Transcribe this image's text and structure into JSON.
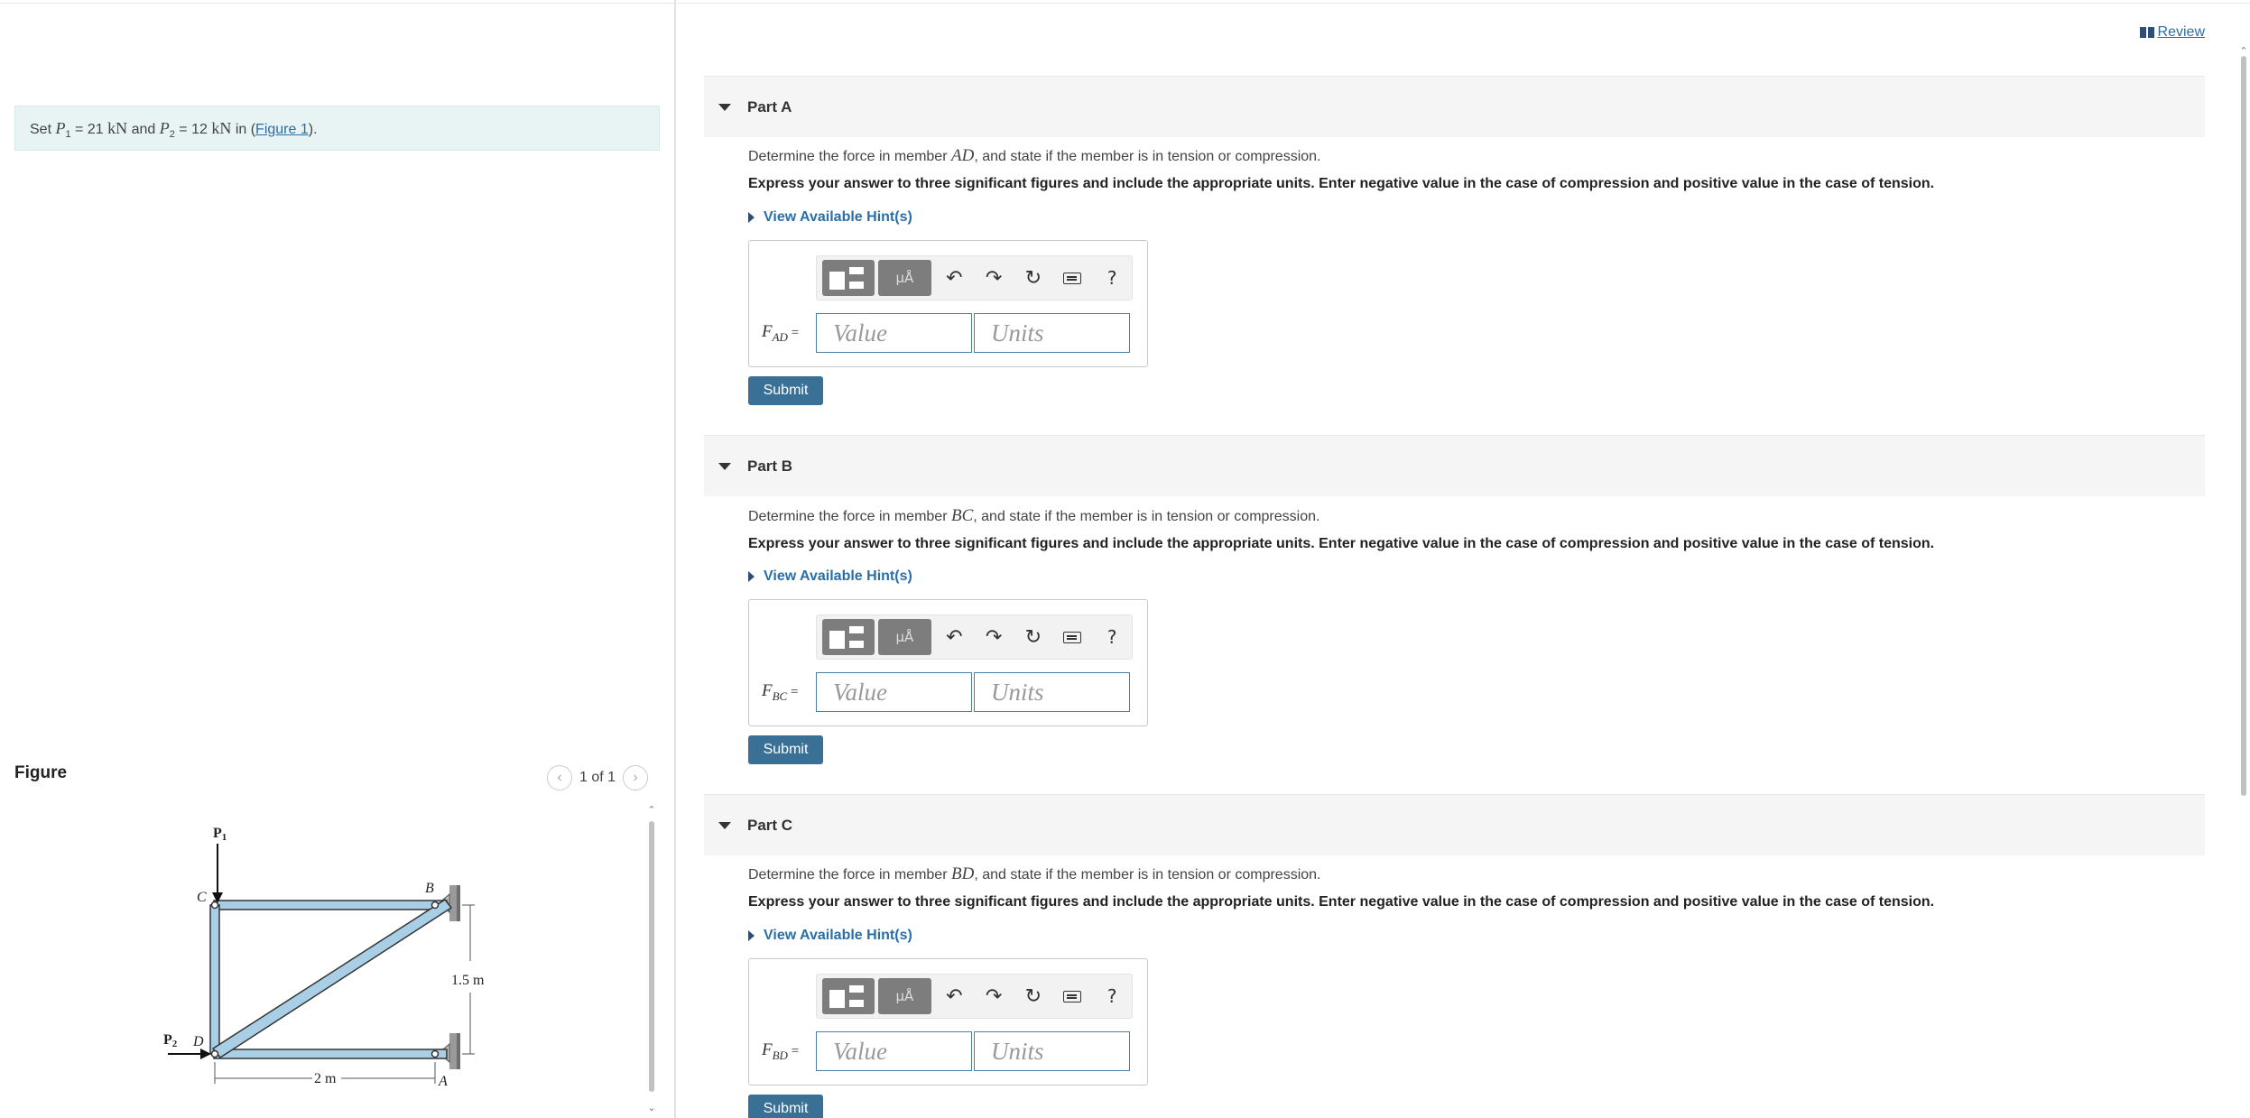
{
  "problem": {
    "prefix": "Set",
    "p1_sym": "P",
    "p1_sub": "1",
    "p1_eq": " = 21",
    "p1_unit": " kN",
    "and_text": " and ",
    "p2_sym": "P",
    "p2_sub": "2",
    "p2_eq": " = 12",
    "p2_unit": " kN",
    "in_text": " in (",
    "figure_link": "Figure 1",
    "close_text": ")."
  },
  "review": {
    "label": " Review"
  },
  "figure": {
    "heading": "Figure",
    "pager_text": "1 of 1",
    "labels": {
      "p1": "P",
      "p1_sub": "1",
      "p2": "P",
      "p2_sub": "2",
      "c": "C",
      "b": "B",
      "d": "D",
      "a": "A",
      "height": "1.5 m",
      "width": "2 m"
    }
  },
  "parts": [
    {
      "title": "Part A",
      "question_pre": "Determine the force in member ",
      "member": "AD",
      "question_post": ", and state if the member is in tension or compression.",
      "instruction": "Express your answer to three significant figures and include the appropriate units. Enter negative value in the case of compression and positive value in the case of tension.",
      "hint": "View Available Hint(s)",
      "label_f": "F",
      "label_sub": "AD",
      "label_eq": " =",
      "value_placeholder": "Value",
      "units_placeholder": "Units",
      "submit": "Submit"
    },
    {
      "title": "Part B",
      "question_pre": "Determine the force in member ",
      "member": "BC",
      "question_post": ", and state if the member is in tension or compression.",
      "instruction": "Express your answer to three significant figures and include the appropriate units. Enter negative value in the case of compression and positive value in the case of tension.",
      "hint": "View Available Hint(s)",
      "label_f": "F",
      "label_sub": "BC",
      "label_eq": " =",
      "value_placeholder": "Value",
      "units_placeholder": "Units",
      "submit": "Submit"
    },
    {
      "title": "Part C",
      "question_pre": "Determine the force in member ",
      "member": "BD",
      "question_post": ", and state if the member is in tension or compression.",
      "instruction": "Express your answer to three significant figures and include the appropriate units. Enter negative value in the case of compression and positive value in the case of tension.",
      "hint": "View Available Hint(s)",
      "label_f": "F",
      "label_sub": "BD",
      "label_eq": " =",
      "value_placeholder": "Value",
      "units_placeholder": "Units",
      "submit": "Submit"
    }
  ],
  "toolbar": {
    "units_btn": "μÅ",
    "undo": "↶",
    "redo": "↷",
    "reset": "↻",
    "help": "?"
  },
  "colors": {
    "accent": "#3a6f96",
    "link": "#2a6ea8",
    "member_fill": "#a9cfe6",
    "problem_bg": "#e7f4f3"
  }
}
